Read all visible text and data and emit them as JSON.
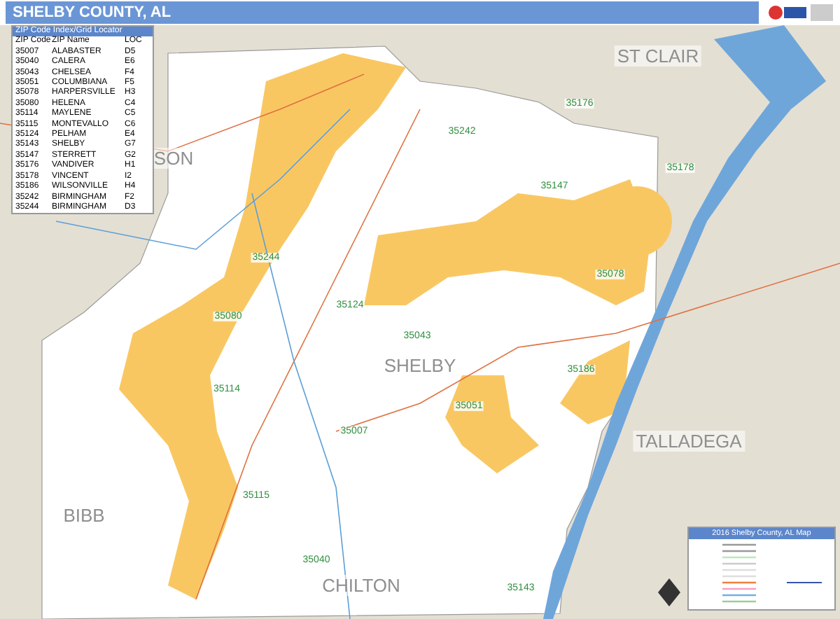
{
  "header": {
    "title": "SHELBY COUNTY, AL"
  },
  "zip_index": {
    "title": "ZIP Code Index/Grid Locator",
    "columns": [
      "ZIP Code",
      "ZIP Name",
      "LOC"
    ],
    "rows": [
      [
        "35007",
        "ALABASTER",
        "D5"
      ],
      [
        "35040",
        "CALERA",
        "E6"
      ],
      [
        "35043",
        "CHELSEA",
        "F4"
      ],
      [
        "35051",
        "COLUMBIANA",
        "F5"
      ],
      [
        "35078",
        "HARPERSVILLE",
        "H3"
      ],
      [
        "35080",
        "HELENA",
        "C4"
      ],
      [
        "35114",
        "MAYLENE",
        "C5"
      ],
      [
        "35115",
        "MONTEVALLO",
        "C6"
      ],
      [
        "35124",
        "PELHAM",
        "E4"
      ],
      [
        "35143",
        "SHELBY",
        "G7"
      ],
      [
        "35147",
        "STERRETT",
        "G2"
      ],
      [
        "35176",
        "VANDIVER",
        "H1"
      ],
      [
        "35178",
        "VINCENT",
        "I2"
      ],
      [
        "35186",
        "WILSONVILLE",
        "H4"
      ],
      [
        "35242",
        "BIRMINGHAM",
        "F2"
      ],
      [
        "35244",
        "BIRMINGHAM",
        "D3"
      ]
    ]
  },
  "map": {
    "county_labels": [
      "ST CLAIR",
      "SON",
      "SHELBY",
      "TALLADEGA",
      "BIBB",
      "CHILTON"
    ],
    "zip_labels": [
      "35176",
      "35242",
      "35147",
      "35178",
      "35244",
      "35124",
      "35078",
      "35080",
      "35043",
      "35186",
      "35051",
      "35114",
      "35007",
      "35115",
      "35040",
      "35143"
    ]
  },
  "legend": {
    "title": "2016 Shelby County, AL Map"
  }
}
